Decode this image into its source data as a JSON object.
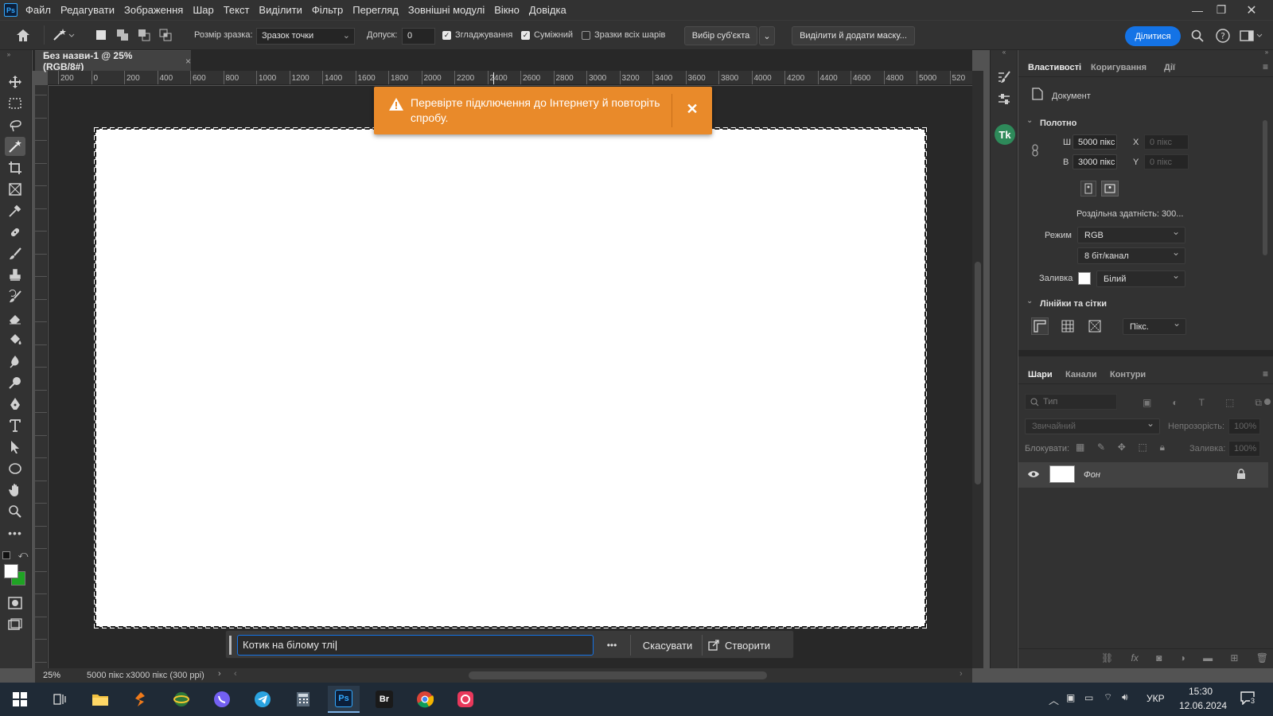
{
  "app": {
    "logo": "Ps"
  },
  "menu": [
    "Файл",
    "Редагувати",
    "Зображення",
    "Шар",
    "Текст",
    "Виділити",
    "Фільтр",
    "Перегляд",
    "Зовнішні модулі",
    "Вікно",
    "Довідка"
  ],
  "options": {
    "sample_size_label": "Розмір зразка:",
    "sample_size_value": "Зразок точки",
    "tolerance_label": "Допуск:",
    "tolerance_value": "0",
    "antialias_label": "Згладжування",
    "antialias_checked": true,
    "contiguous_label": "Суміжний",
    "contiguous_checked": true,
    "all_layers_label": "Зразки всіх шарів",
    "all_layers_checked": false,
    "select_subject": "Вибір суб'єкта",
    "select_and_mask": "Виділити й додати маску...",
    "share": "Ділитися"
  },
  "document": {
    "tab_title": "Без назви-1 @ 25% (RGB/8#)",
    "zoom": "25%",
    "doc_size": "5000 пікс х3000 пікс (300 ppi)"
  },
  "ruler": {
    "h_ticks": [
      "200",
      "0",
      "200",
      "400",
      "600",
      "800",
      "1000",
      "1200",
      "1400",
      "1600",
      "1800",
      "2000",
      "2200",
      "2400",
      "2600",
      "2800",
      "3000",
      "3200",
      "3400",
      "3600",
      "3800",
      "4000",
      "4200",
      "4400",
      "4600",
      "4800",
      "5000",
      "520"
    ]
  },
  "toast": {
    "message": "Перевірте підключення до Інтернету й повторіть спробу.",
    "color": "#e98a2a"
  },
  "generate": {
    "prompt_value": "Котик на білому тлі",
    "more": "•••",
    "cancel": "Скасувати",
    "create": "Створити"
  },
  "properties": {
    "tabs": [
      "Властивості",
      "Коригування",
      "Дії"
    ],
    "doc_label": "Документ",
    "canvas_title": "Полотно",
    "w_label": "Ш",
    "w_value": "5000 пікс",
    "h_label": "В",
    "h_value": "3000 пікс",
    "x_label": "X",
    "x_value": "0 пікс",
    "y_label": "Y",
    "y_value": "0 пікс",
    "resolution": "Роздільна здатність: 300...",
    "mode_label": "Режим",
    "mode_value": "RGB",
    "depth_value": "8 біт/канал",
    "fill_label": "Заливка",
    "fill_value": "Білий",
    "rulers_title": "Лінійки та сітки",
    "units_value": "Пікс."
  },
  "layers": {
    "tabs": [
      "Шари",
      "Канали",
      "Контури"
    ],
    "search_placeholder": "Тип",
    "blend_mode": "Звичайний",
    "opacity_label": "Непрозорість:",
    "opacity_value": "100%",
    "lock_label": "Блокувати:",
    "fill_label": "Заливка:",
    "fill_value": "100%",
    "items": [
      {
        "name": "Фон"
      }
    ]
  },
  "taskbar": {
    "lang": "УКР",
    "time": "15:30",
    "date": "12.06.2024",
    "notif_count": "3",
    "bridge": "Br"
  }
}
